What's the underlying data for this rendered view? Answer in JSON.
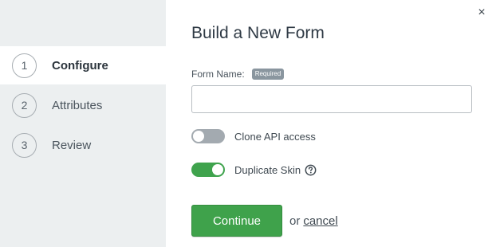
{
  "steps": [
    {
      "number": "1",
      "label": "Configure",
      "active": true
    },
    {
      "number": "2",
      "label": "Attributes",
      "active": false
    },
    {
      "number": "3",
      "label": "Review",
      "active": false
    }
  ],
  "dialog": {
    "title": "Build a New Form",
    "close_icon": "close-icon",
    "close_glyph": "×"
  },
  "form_name": {
    "label": "Form Name:",
    "badge": "Required",
    "value": "",
    "placeholder": ""
  },
  "toggles": {
    "clone_api": {
      "label": "Clone API access",
      "state": "off"
    },
    "duplicate_skin": {
      "label": "Duplicate Skin",
      "state": "on",
      "help_icon": "question-circle-icon"
    }
  },
  "actions": {
    "continue_label": "Continue",
    "or_text": "or",
    "cancel_label": "cancel"
  },
  "colors": {
    "sidebar_bg": "#eceff0",
    "accent_green": "#3fa24b",
    "toggle_off": "#a3aab0",
    "badge_bg": "#8a969f"
  }
}
